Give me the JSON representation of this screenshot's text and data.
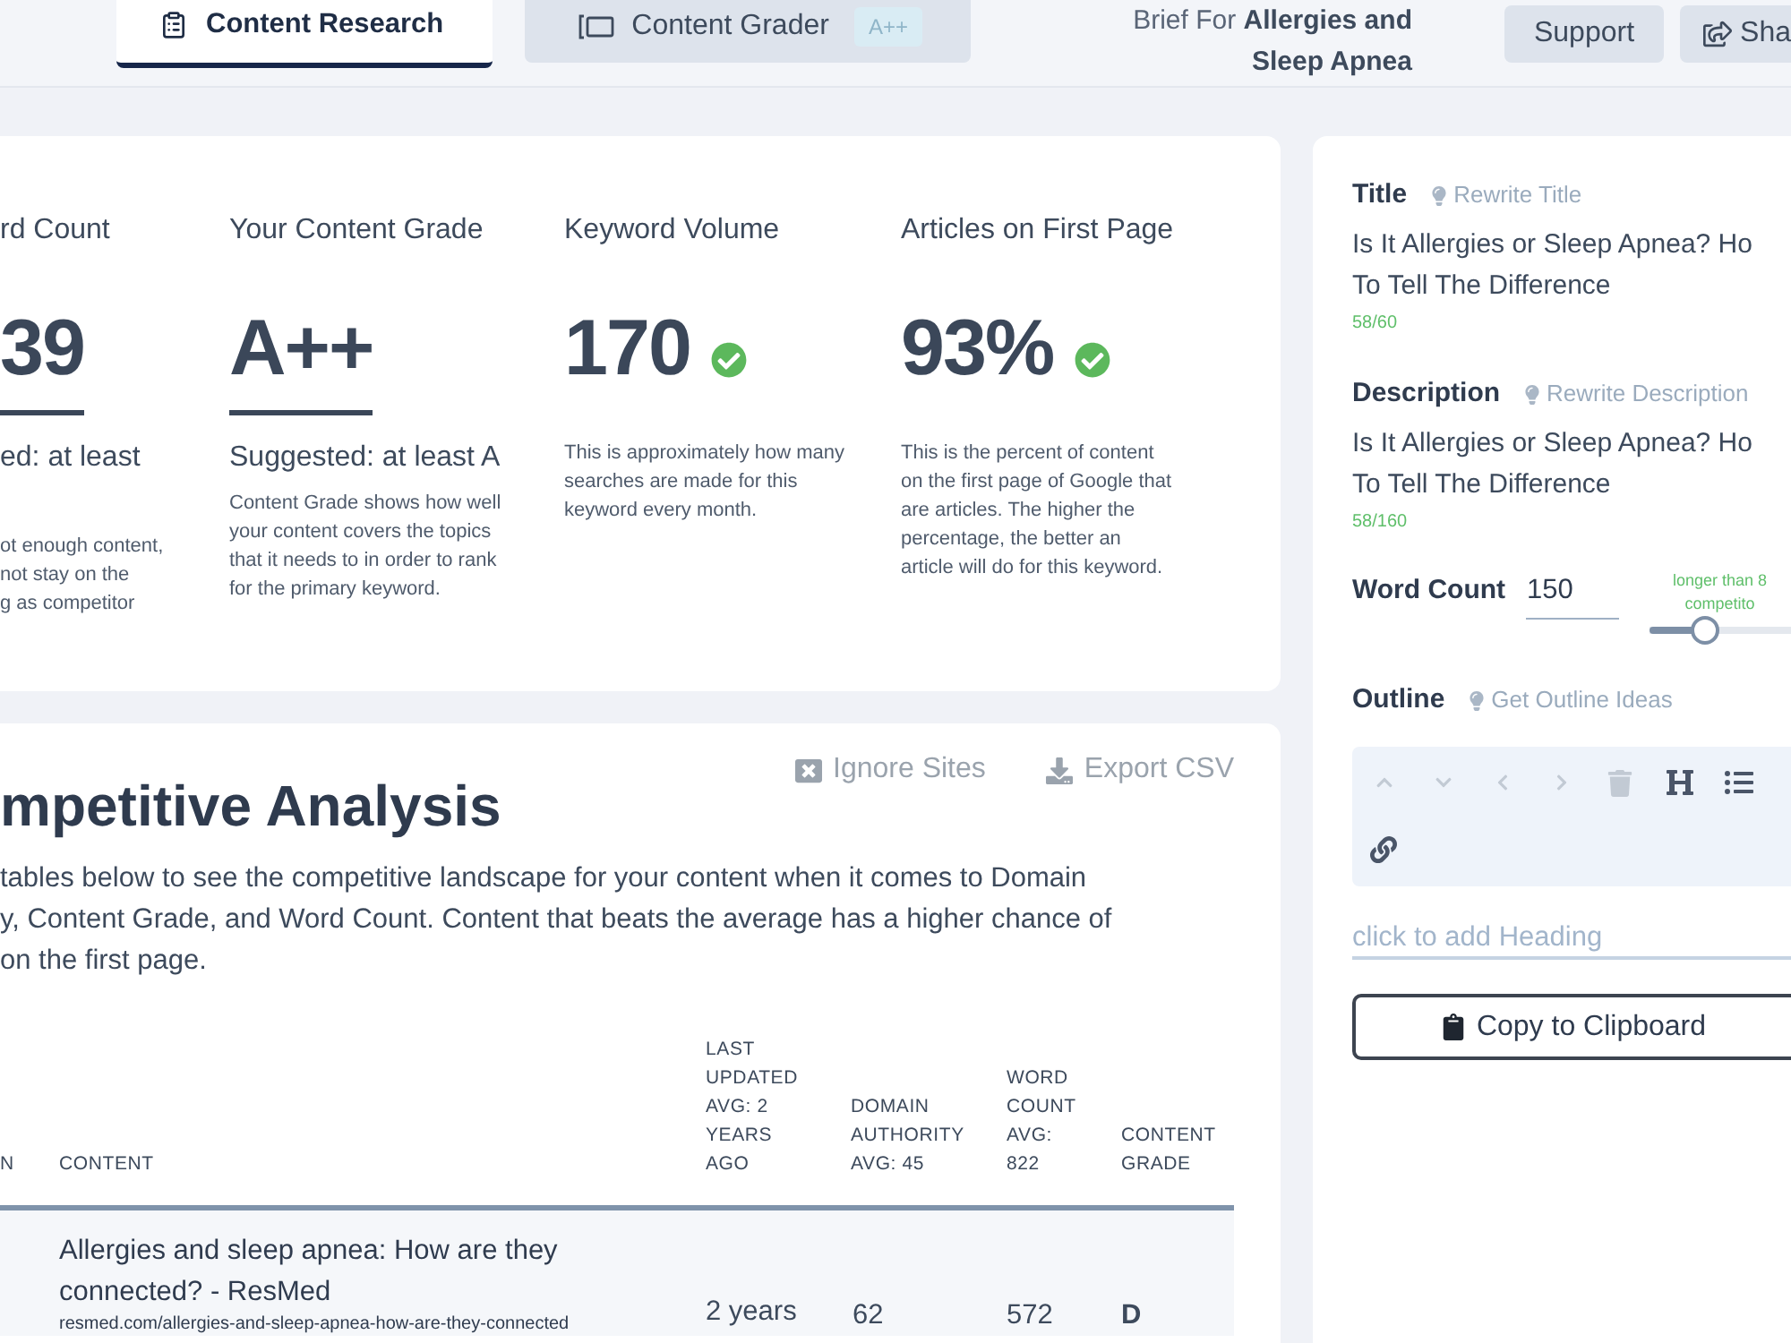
{
  "nav": {
    "tabs": [
      {
        "label": "Content Research",
        "selected": true
      },
      {
        "label": "Content Grader",
        "badge": "A++",
        "selected": false
      }
    ],
    "brief": "Brief For **Allergies and Sleep Apnea**",
    "buttons": [
      {
        "label": "Support",
        "kind": "plain"
      },
      {
        "label": "Sha",
        "kind": "share"
      }
    ]
  },
  "stats": [
    {
      "title": "rd Count",
      "value": "39",
      "suggested": "ed: at least",
      "description": [
        "ot enough content,",
        "not stay on the",
        "g as competitor"
      ]
    },
    {
      "title": "Your Content Grade",
      "value": "A++",
      "suggested": "Suggested: at least A",
      "description": [
        "Content Grade shows how well",
        "your content covers the topics",
        "that it needs to in order to rank",
        "for the primary keyword."
      ]
    },
    {
      "title": "Keyword Volume",
      "value": "170",
      "check": true,
      "description": [
        "This is approximately how many",
        "searches are made for this",
        "keyword every month."
      ]
    },
    {
      "title": "Articles on First Page",
      "value": "93%",
      "check": true,
      "description": [
        "This is the percent of content",
        "on the first page of Google that",
        "are articles. The higher the",
        "percentage, the better an",
        "article will do for this keyword."
      ]
    }
  ],
  "competitive": {
    "actions": [
      {
        "label": "Ignore Sites"
      },
      {
        "label": "Export CSV"
      }
    ],
    "title": "mpetitive Analysis",
    "intro": [
      "tables below to see the competitive landscape for your content when it comes to Domain",
      "y, Content Grade, and Word Count. Content that beats the average has a higher chance of",
      "on the first page."
    ],
    "columns": [
      "N",
      "CONTENT",
      "LAST UPDATED AVG: 2 YEARS AGO",
      "DOMAIN AUTHORITY AVG: 45",
      "WORD COUNT AVG: 822",
      "CONTENT GRADE"
    ],
    "rows": [
      {
        "title": "Allergies and sleep apnea: How are they connected? - ResMed",
        "url": "resmed.com/allergies-and-sleep-apnea-how-are-they-connected",
        "last_updated": "2 years",
        "domain_authority": "62",
        "word_count": "572",
        "grade": "D"
      }
    ]
  },
  "brief_panel": {
    "title": {
      "label": "Title",
      "action": "Rewrite Title",
      "lines": [
        "Is It Allergies or Sleep Apnea? Ho",
        "To Tell The Difference"
      ],
      "count": "58/60"
    },
    "description": {
      "label": "Description",
      "action": "Rewrite Description",
      "lines": [
        "Is It Allergies or Sleep Apnea? Ho",
        "To Tell The Difference"
      ],
      "count": "58/160"
    },
    "word_count": {
      "label": "Word Count",
      "value": "150",
      "hint": [
        "longer than 8",
        "competito"
      ],
      "level": 0.4
    },
    "outline": {
      "label": "Outline",
      "action": "Get Outline Ideas",
      "tools": [
        {
          "disabled": true
        },
        {
          "disabled": true
        },
        {
          "disabled": true
        },
        {
          "disabled": true
        },
        {
          "disabled": true
        },
        {
          "disabled": false
        },
        {
          "disabled": false
        },
        {
          "disabled": false
        }
      ],
      "heading_placeholder": "click to add Heading"
    },
    "copy_button": "Copy to Clipboard"
  }
}
